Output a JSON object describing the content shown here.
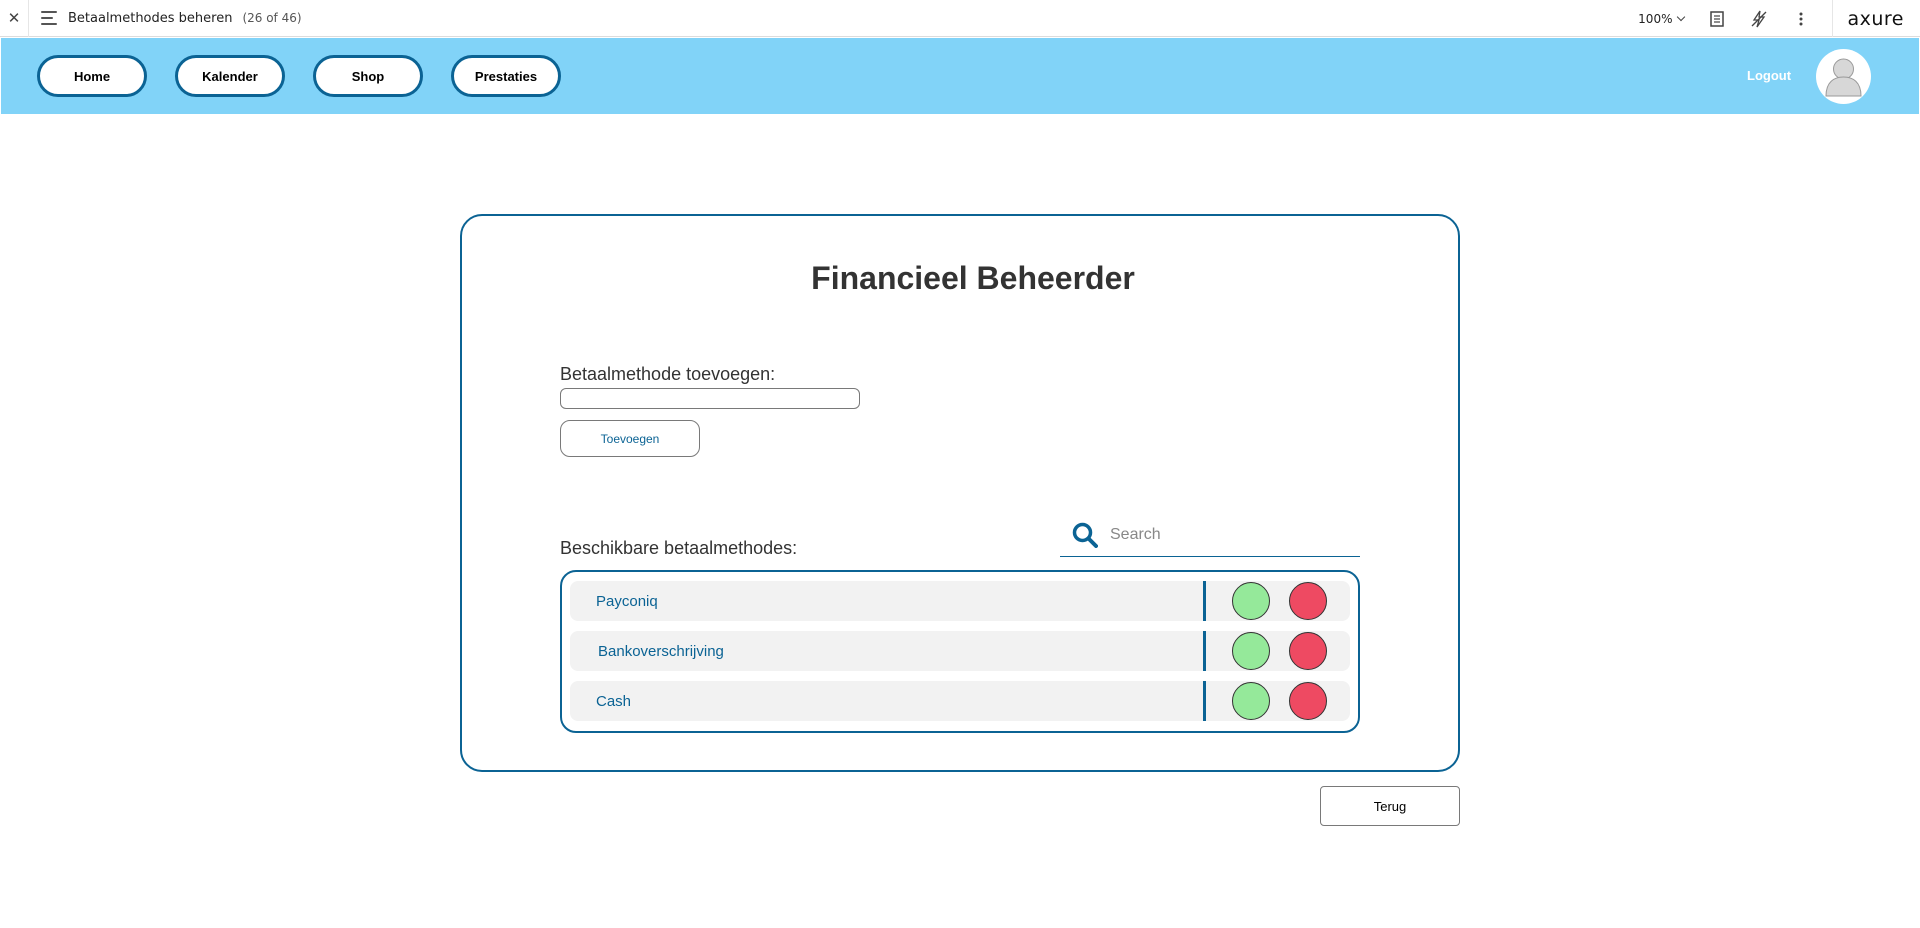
{
  "axure": {
    "close_glyph": "✕",
    "page_name": "Betaalmethodes beheren",
    "page_count": "(26 of 46)",
    "zoom": "100%",
    "logo": "axure"
  },
  "nav": {
    "items": [
      {
        "label": "Home"
      },
      {
        "label": "Kalender"
      },
      {
        "label": "Shop"
      },
      {
        "label": "Prestaties"
      }
    ],
    "logout": "Logout",
    "bg_color": "#81d3f8",
    "accent_color": "#0b6394"
  },
  "main": {
    "title": "Financieel Beheerder",
    "add_label": "Betaalmethode toevoegen:",
    "add_input_value": "",
    "add_button": "Toevoegen",
    "list_label": "Beschikbare betaalmethodes:",
    "search_placeholder": "Search",
    "methods": [
      {
        "name": "Payconiq"
      },
      {
        "name": "Bankoverschrijving"
      },
      {
        "name": "Cash"
      }
    ],
    "approve_color": "#95e99a",
    "delete_color": "#ee4a62",
    "back_button": "Terug"
  }
}
